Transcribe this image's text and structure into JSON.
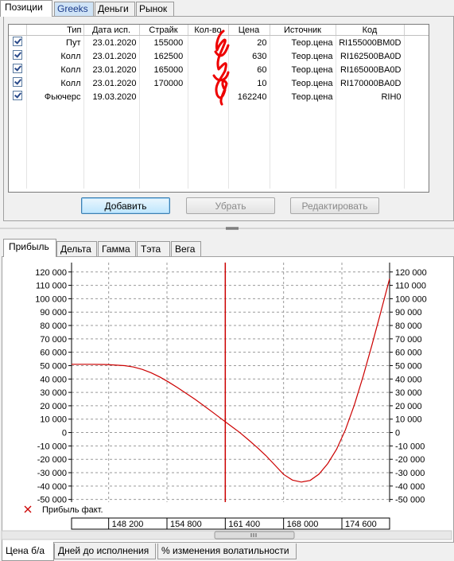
{
  "top_tabs": [
    "Позиции",
    "Greeks",
    "Деньги",
    "Рынок"
  ],
  "positions": {
    "columns": [
      "Тип",
      "Дата исп.",
      "Страйк",
      "Кол-во",
      "Цена",
      "Источник",
      "Код"
    ],
    "rows": [
      {
        "checked": true,
        "type": "Пут",
        "date": "23.01.2020",
        "strike": "155000",
        "qty": "",
        "price": "20",
        "source": "Теор.цена",
        "code": "RI155000BM0D"
      },
      {
        "checked": true,
        "type": "Колл",
        "date": "23.01.2020",
        "strike": "162500",
        "qty": "",
        "price": "630",
        "source": "Теор.цена",
        "code": "RI162500BA0D"
      },
      {
        "checked": true,
        "type": "Колл",
        "date": "23.01.2020",
        "strike": "165000",
        "qty": "",
        "price": "60",
        "source": "Теор.цена",
        "code": "RI165000BA0D"
      },
      {
        "checked": true,
        "type": "Колл",
        "date": "23.01.2020",
        "strike": "170000",
        "qty": "",
        "price": "10",
        "source": "Теор.цена",
        "code": "RI170000BA0D"
      },
      {
        "checked": true,
        "type": "Фьючерс",
        "date": "19.03.2020",
        "strike": "",
        "qty": "",
        "price": "162240",
        "source": "Теор.цена",
        "code": "RIH0"
      }
    ]
  },
  "buttons": {
    "add": "Добавить",
    "remove": "Убрать",
    "edit": "Редактировать"
  },
  "chart_tabs": [
    "Прибыль",
    "Дельта",
    "Гамма",
    "Тэта",
    "Вега"
  ],
  "bottom_tabs": [
    "Цена б/а",
    "Дней до исполнения",
    "% изменения волатильности"
  ],
  "colors": {
    "curve": "#cc0000",
    "vline": "#cc0000",
    "redaction": "#ee0000",
    "grid": "#9a9a9a"
  },
  "chart_data": {
    "type": "line",
    "series": [
      {
        "name": "Прибыль факт.",
        "x": [
          144000,
          146000,
          148000,
          150000,
          151000,
          152000,
          153000,
          154000,
          155000,
          156000,
          157000,
          158000,
          159000,
          160000,
          161000,
          162000,
          163000,
          164000,
          165000,
          166000,
          167000,
          168000,
          169000,
          170000,
          171000,
          172000,
          173000,
          174000,
          175000,
          176000,
          177000,
          178000,
          179000,
          180000
        ],
        "y": [
          51000,
          51000,
          50800,
          50000,
          49000,
          47200,
          44700,
          41500,
          37700,
          33600,
          29200,
          24700,
          19900,
          15000,
          10000,
          5100,
          200,
          -5300,
          -11100,
          -17200,
          -24300,
          -31300,
          -35500,
          -37000,
          -35800,
          -31100,
          -23200,
          -12500,
          2000,
          20500,
          42000,
          65400,
          90000,
          115000
        ]
      }
    ],
    "legend": "Прибыль факт.",
    "legend_position": "bottom-left",
    "xlim": [
      144000,
      180000
    ],
    "ylim": [
      -52000,
      127000
    ],
    "x_ticks": [
      148200,
      154800,
      161400,
      168000,
      174600
    ],
    "x_tick_labels": [
      "148 200",
      "154 800",
      "161 400",
      "168 000",
      "174 600"
    ],
    "y_ticks": [
      120000,
      110000,
      100000,
      90000,
      80000,
      70000,
      60000,
      50000,
      40000,
      30000,
      20000,
      10000,
      0,
      -10000,
      -20000,
      -30000,
      -40000,
      -50000
    ],
    "y_tick_labels": [
      "120 000",
      "110 000",
      "100 000",
      "90 000",
      "80 000",
      "70 000",
      "60 000",
      "50 000",
      "40 000",
      "30 000",
      "20 000",
      "10 000",
      "0",
      "-10 000",
      "-20 000",
      "-30 000",
      "-40 000",
      "-50 000"
    ],
    "vertical_line_x": 161400,
    "grid": true
  }
}
